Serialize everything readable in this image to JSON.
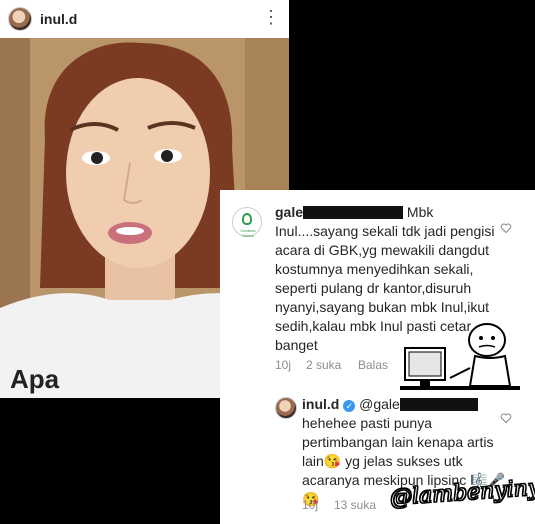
{
  "post": {
    "username": "inul.d",
    "more_icon": "more-vertical-icon"
  },
  "comment": {
    "user": "gale",
    "text": "Mbk Inul....sayang sekali tdk jadi pengisi acara di GBK,yg mewakili dangdut kostumnya menyedihkan sekali, seperti pulang dr kantor,disuruh nyanyi,sayang bukan mbk Inul,ikut sedih,kalau mbk Inul pasti cetar banget",
    "time": "10j",
    "likes": "2 suka",
    "reply": "Balas",
    "avatar_caption": "Gerakan Sentra"
  },
  "reply": {
    "user": "inul.d",
    "mention": "@gale",
    "text": "hehehee pasti punya pertimbangan lain kenapa artis lain😘 yg jelas sukses utk acaranya meskipun lipsinc 🎼🎤😘",
    "time": "10j",
    "likes": "13 suka"
  },
  "watermark": "@lambenyinyir",
  "colors": {
    "verified": "#3897f0",
    "text": "#262626",
    "meta": "#8e8e8e"
  }
}
